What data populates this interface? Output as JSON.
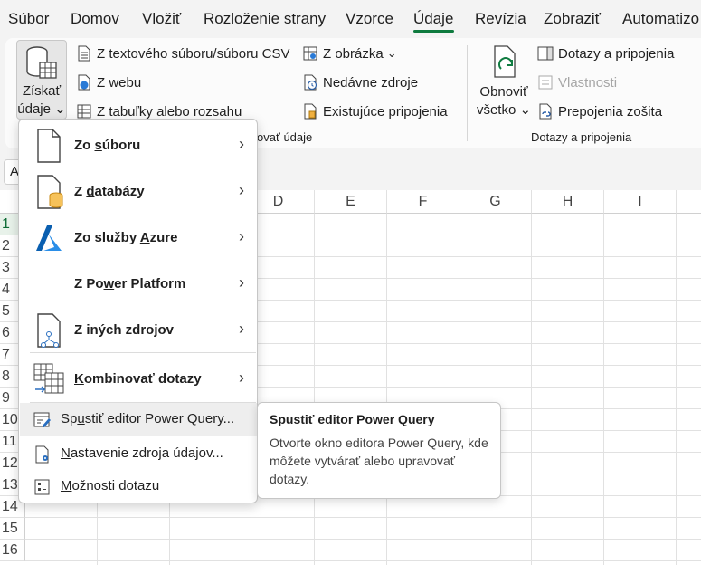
{
  "menu": {
    "tabs": [
      "Súbor",
      "Domov",
      "Vložiť",
      "Rozloženie strany",
      "Vzorce",
      "Údaje",
      "Revízia",
      "Zobraziť",
      "Automatizo"
    ],
    "active_tab": "Údaje"
  },
  "ribbon": {
    "get_data": {
      "line1": "Získať",
      "line2": "údaje",
      "chevron": "⌄"
    },
    "from_text_csv": "Z textového súboru/súboru CSV",
    "from_web": "Z webu",
    "from_table": "Z tabuľky alebo rozsahu",
    "from_picture": "Z obrázka",
    "recent_sources": "Nedávne zdroje",
    "existing_connections": "Existujúce pripojenia",
    "group_transform_partial": "ovať údaje",
    "refresh_all": {
      "line1": "Obnoviť",
      "line2": "všetko"
    },
    "queries_connections": "Dotazy a pripojenia",
    "properties": "Vlastnosti",
    "edit_links": "Prepojenia zošita",
    "group_queries_label": "Dotazy a pripojenia"
  },
  "name_box": "A",
  "grid": {
    "columns": [
      "D",
      "E",
      "F",
      "G",
      "H",
      "I"
    ],
    "rows": [
      "1",
      "2",
      "3",
      "4",
      "5",
      "6",
      "7",
      "8",
      "9",
      "10",
      "11",
      "12",
      "13",
      "14",
      "15",
      "16"
    ],
    "selected_row": "1"
  },
  "dropdown": {
    "items": [
      {
        "label_pre": "Zo ",
        "label_u": "s",
        "label_post": "úboru",
        "icon": "file-icon"
      },
      {
        "label_pre": "Z ",
        "label_u": "d",
        "label_post": "atabázy",
        "icon": "database-icon"
      },
      {
        "label_pre": "Zo služby ",
        "label_u": "A",
        "label_post": "zure",
        "icon": "azure-icon"
      },
      {
        "label_pre": "Z Po",
        "label_u": "w",
        "label_post": "er Platform",
        "icon": ""
      },
      {
        "label_pre": "Z iných zdro",
        "label_u": "j",
        "label_post": "ov",
        "icon": "other-sources-icon"
      },
      {
        "label_pre": "",
        "label_u": "K",
        "label_post": "ombinovať dotazy",
        "icon": "combine-queries-icon"
      }
    ],
    "launch_pq": {
      "pre": "Sp",
      "u": "u",
      "post": "stiť editor Power Query..."
    },
    "data_source_settings": {
      "pre": "",
      "u": "N",
      "post": "astavenie zdroja údajov..."
    },
    "query_options": {
      "pre": "",
      "u": "M",
      "post": "ožnosti dotazu"
    }
  },
  "tooltip": {
    "title": "Spustiť editor Power Query",
    "body": "Otvorte okno editora Power Query, kde môžete vytvárať alebo upravovať dotazy."
  },
  "colors": {
    "accent": "#107c41",
    "azure_blue": "#0a6ed1",
    "db_orange": "#e8a33d"
  }
}
